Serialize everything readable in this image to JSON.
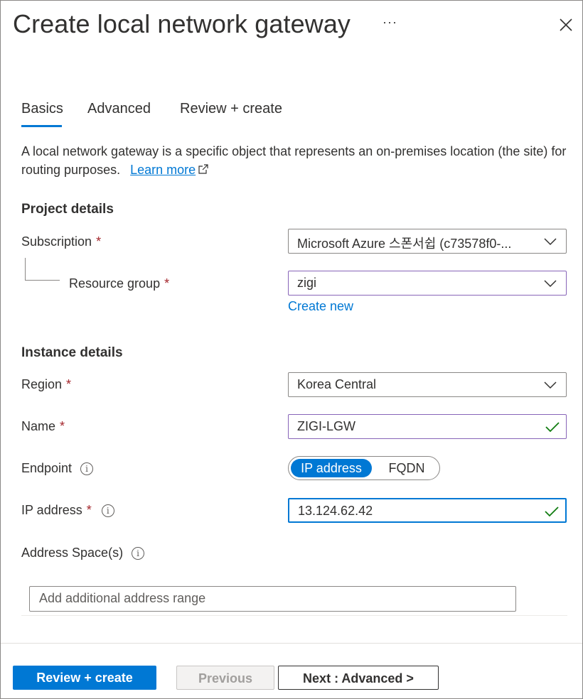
{
  "header": {
    "title": "Create local network gateway",
    "more_label": "···"
  },
  "tabs": [
    {
      "label": "Basics"
    },
    {
      "label": "Advanced"
    },
    {
      "label": "Review + create"
    }
  ],
  "description": {
    "text": "A local network gateway is a specific object that represents an on-premises location (the site) for routing purposes.",
    "link": "Learn more"
  },
  "project": {
    "heading": "Project details",
    "subscription_label": "Subscription",
    "subscription_value": "Microsoft Azure 스폰서쉽 (c73578f0-...",
    "resource_group_label": "Resource group",
    "resource_group_value": "zigi",
    "create_new": "Create new"
  },
  "instance": {
    "heading": "Instance details",
    "region_label": "Region",
    "region_value": "Korea Central",
    "name_label": "Name",
    "name_value": "ZIGI-LGW",
    "endpoint_label": "Endpoint",
    "endpoint_options": [
      "IP address",
      "FQDN"
    ],
    "ip_label": "IP address",
    "ip_value": "13.124.62.42",
    "address_space_label": "Address Space(s)",
    "address_placeholder": "Add additional address range"
  },
  "required_mark": "*",
  "info_glyph": "i",
  "footer": {
    "review_create": "Review + create",
    "previous": "Previous",
    "next": "Next : Advanced >"
  },
  "colors": {
    "accent": "#0078d4",
    "required": "#a4262c",
    "valid": "#107c10",
    "edited_border": "#8764b8"
  }
}
